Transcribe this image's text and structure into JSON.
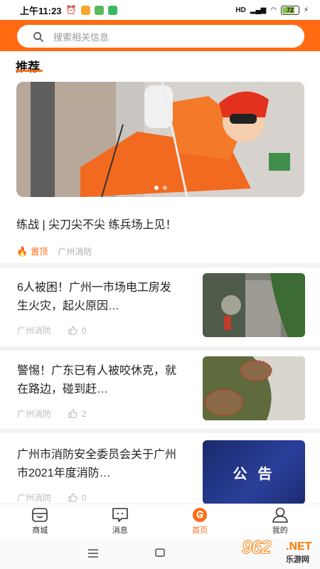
{
  "status_bar": {
    "time": "上午11:23",
    "network": "HD",
    "battery": "72",
    "battery_level": 0.72
  },
  "search": {
    "placeholder": "搜索相关信息",
    "icon": "search-icon"
  },
  "section": {
    "title": "推荐"
  },
  "hero": {
    "title": "练战 | 尖刀尖不尖 练兵场上见！",
    "pin_label": "置顶",
    "source": "广州消防",
    "slide_count": 2,
    "active_slide": 1
  },
  "news": [
    {
      "title": "6人被困！广州一市场电工房发生火灾，起火原因…",
      "source": "广州消防",
      "likes": "0"
    },
    {
      "title": "警惕！广东已有人被咬休克，就在路边，碰到赶…",
      "source": "广州消防",
      "likes": "2"
    },
    {
      "title": "广州市消防安全委员会关于广州市2021年度消防…",
      "source": "广州消防",
      "likes": "0",
      "thumb_text": "公 告"
    }
  ],
  "tabs": [
    {
      "label": "商城",
      "icon": "shop-icon"
    },
    {
      "label": "消息",
      "icon": "message-icon"
    },
    {
      "label": "首页",
      "icon": "home-logo-icon",
      "active": true
    },
    {
      "label": "我的",
      "icon": "profile-icon"
    }
  ],
  "watermark": {
    "number": "962",
    "net": ".NET",
    "sub": "乐游网"
  },
  "colors": {
    "accent": "#ff6a13",
    "divider": "#f2f2f2"
  }
}
